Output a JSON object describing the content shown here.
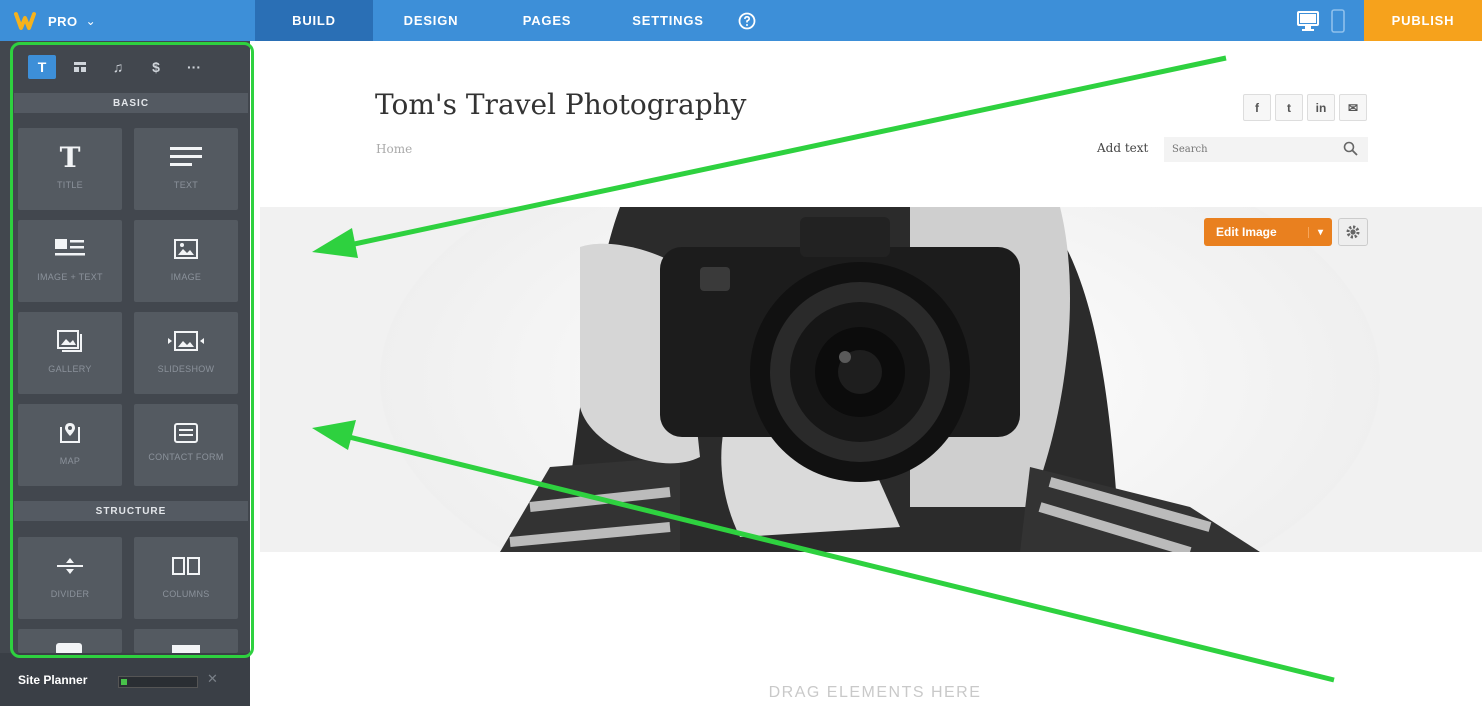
{
  "topbar": {
    "plan_label": "PRO",
    "tabs": [
      {
        "label": "BUILD"
      },
      {
        "label": "DESIGN"
      },
      {
        "label": "PAGES"
      },
      {
        "label": "SETTINGS"
      }
    ],
    "publish_label": "PUBLISH",
    "colors": {
      "bar": "#3d8fd8",
      "active_tab": "#2a6fb5",
      "publish": "#f6a21c"
    }
  },
  "sidebar": {
    "category_icons": [
      "text-icon",
      "layout-icon",
      "music-icon",
      "dollar-icon",
      "more-icon"
    ],
    "basic_header": "BASIC",
    "structure_header": "STRUCTURE",
    "basic_elements": [
      {
        "label": "TITLE",
        "icon": "title-icon"
      },
      {
        "label": "TEXT",
        "icon": "text-lines-icon"
      },
      {
        "label": "IMAGE + TEXT",
        "icon": "image-text-icon"
      },
      {
        "label": "IMAGE",
        "icon": "image-icon"
      },
      {
        "label": "GALLERY",
        "icon": "gallery-icon"
      },
      {
        "label": "SLIDESHOW",
        "icon": "slideshow-icon"
      },
      {
        "label": "MAP",
        "icon": "map-pin-icon"
      },
      {
        "label": "CONTACT FORM",
        "icon": "form-icon"
      }
    ],
    "structure_elements": [
      {
        "label": "DIVIDER",
        "icon": "divider-icon"
      },
      {
        "label": "COLUMNS",
        "icon": "columns-icon"
      }
    ],
    "site_planner": {
      "label": "Site Planner",
      "progress": 0.08
    }
  },
  "page": {
    "title": "Tom's Travel Photography",
    "breadcrumb": "Home",
    "social": [
      "f",
      "t",
      "in",
      "✉"
    ],
    "add_text": "Add text",
    "search_placeholder": "Search",
    "edit_image_label": "Edit Image",
    "drop_hint": "DRAG ELEMENTS HERE"
  },
  "annotation_color": "#2ed13f"
}
